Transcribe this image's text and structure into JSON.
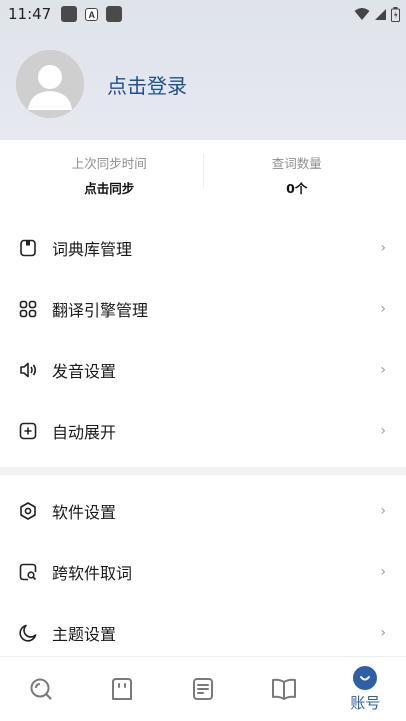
{
  "status_bar": {
    "time": "11:47",
    "notif_a": "A"
  },
  "profile": {
    "login_text": "点击登录"
  },
  "stats": {
    "sync_label": "上次同步时间",
    "sync_value": "点击同步",
    "lookup_label": "查词数量",
    "lookup_value": "0个"
  },
  "menu_group_1": [
    {
      "label": "词典库管理",
      "icon": "dictionary-icon"
    },
    {
      "label": "翻译引擎管理",
      "icon": "grid-icon"
    },
    {
      "label": "发音设置",
      "icon": "speaker-icon"
    },
    {
      "label": "自动展开",
      "icon": "plus-square-icon"
    }
  ],
  "menu_group_2": [
    {
      "label": "软件设置",
      "icon": "hexagon-settings-icon"
    },
    {
      "label": "跨软件取词",
      "icon": "search-square-icon"
    },
    {
      "label": "主题设置",
      "icon": "moon-icon"
    }
  ],
  "bottom_nav": {
    "active_label": "账号",
    "items": [
      "search-icon",
      "robot-icon",
      "notes-icon",
      "book-icon",
      "account-icon"
    ]
  },
  "colors": {
    "accent": "#2f5fa6",
    "login_text": "#1f4f8c",
    "header_bg": "#e2e6ec"
  }
}
